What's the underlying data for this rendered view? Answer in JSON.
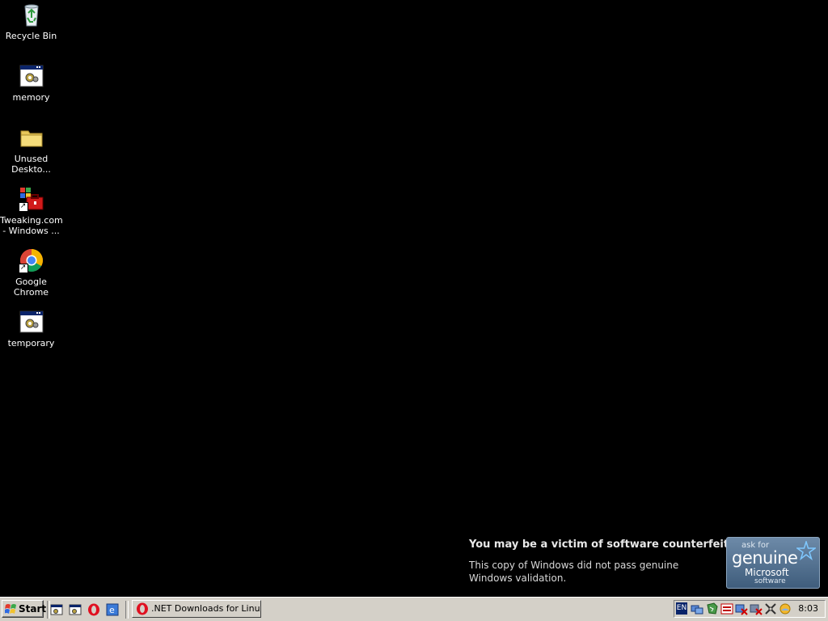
{
  "desktop": {
    "icons": [
      {
        "label": "Recycle Bin",
        "icon": "recycle-bin-icon"
      },
      {
        "label": "memory",
        "icon": "batch-file-icon"
      },
      {
        "label": "Unused\nDeskto...",
        "icon": "folder-icon"
      },
      {
        "label": "Tweaking.com\n- Windows ...",
        "icon": "toolbox-icon"
      },
      {
        "label": "Google Chrome",
        "icon": "chrome-icon"
      },
      {
        "label": "temporary",
        "icon": "batch-file-icon"
      }
    ]
  },
  "watermark": {
    "title": "You may be a victim of software counterfeiting.",
    "body": "This copy of Windows did not pass genuine Windows validation.",
    "badge": {
      "ask": "ask for",
      "genuine": "genuine",
      "microsoft": "Microsoft",
      "software": "software"
    }
  },
  "taskbar": {
    "start_label": "Start",
    "quick_launch": [
      "show-desktop-icon",
      "batch-window-icon",
      "opera-icon",
      "ie-icon"
    ],
    "tasks": [
      {
        "label": ".NET Downloads for Linu...",
        "icon": "opera-icon"
      }
    ],
    "tray": {
      "language": "EN",
      "clock": "8:03",
      "icons": [
        "network-icon",
        "security-icon",
        "disk-icon",
        "error-icon",
        "network-disconnected-icon",
        "tools-icon",
        "weather-icon"
      ]
    }
  },
  "colors": {
    "desktop_bg": "#000000",
    "taskbar_bg": "#d4d0c8",
    "icon_label": "#ffffff"
  }
}
